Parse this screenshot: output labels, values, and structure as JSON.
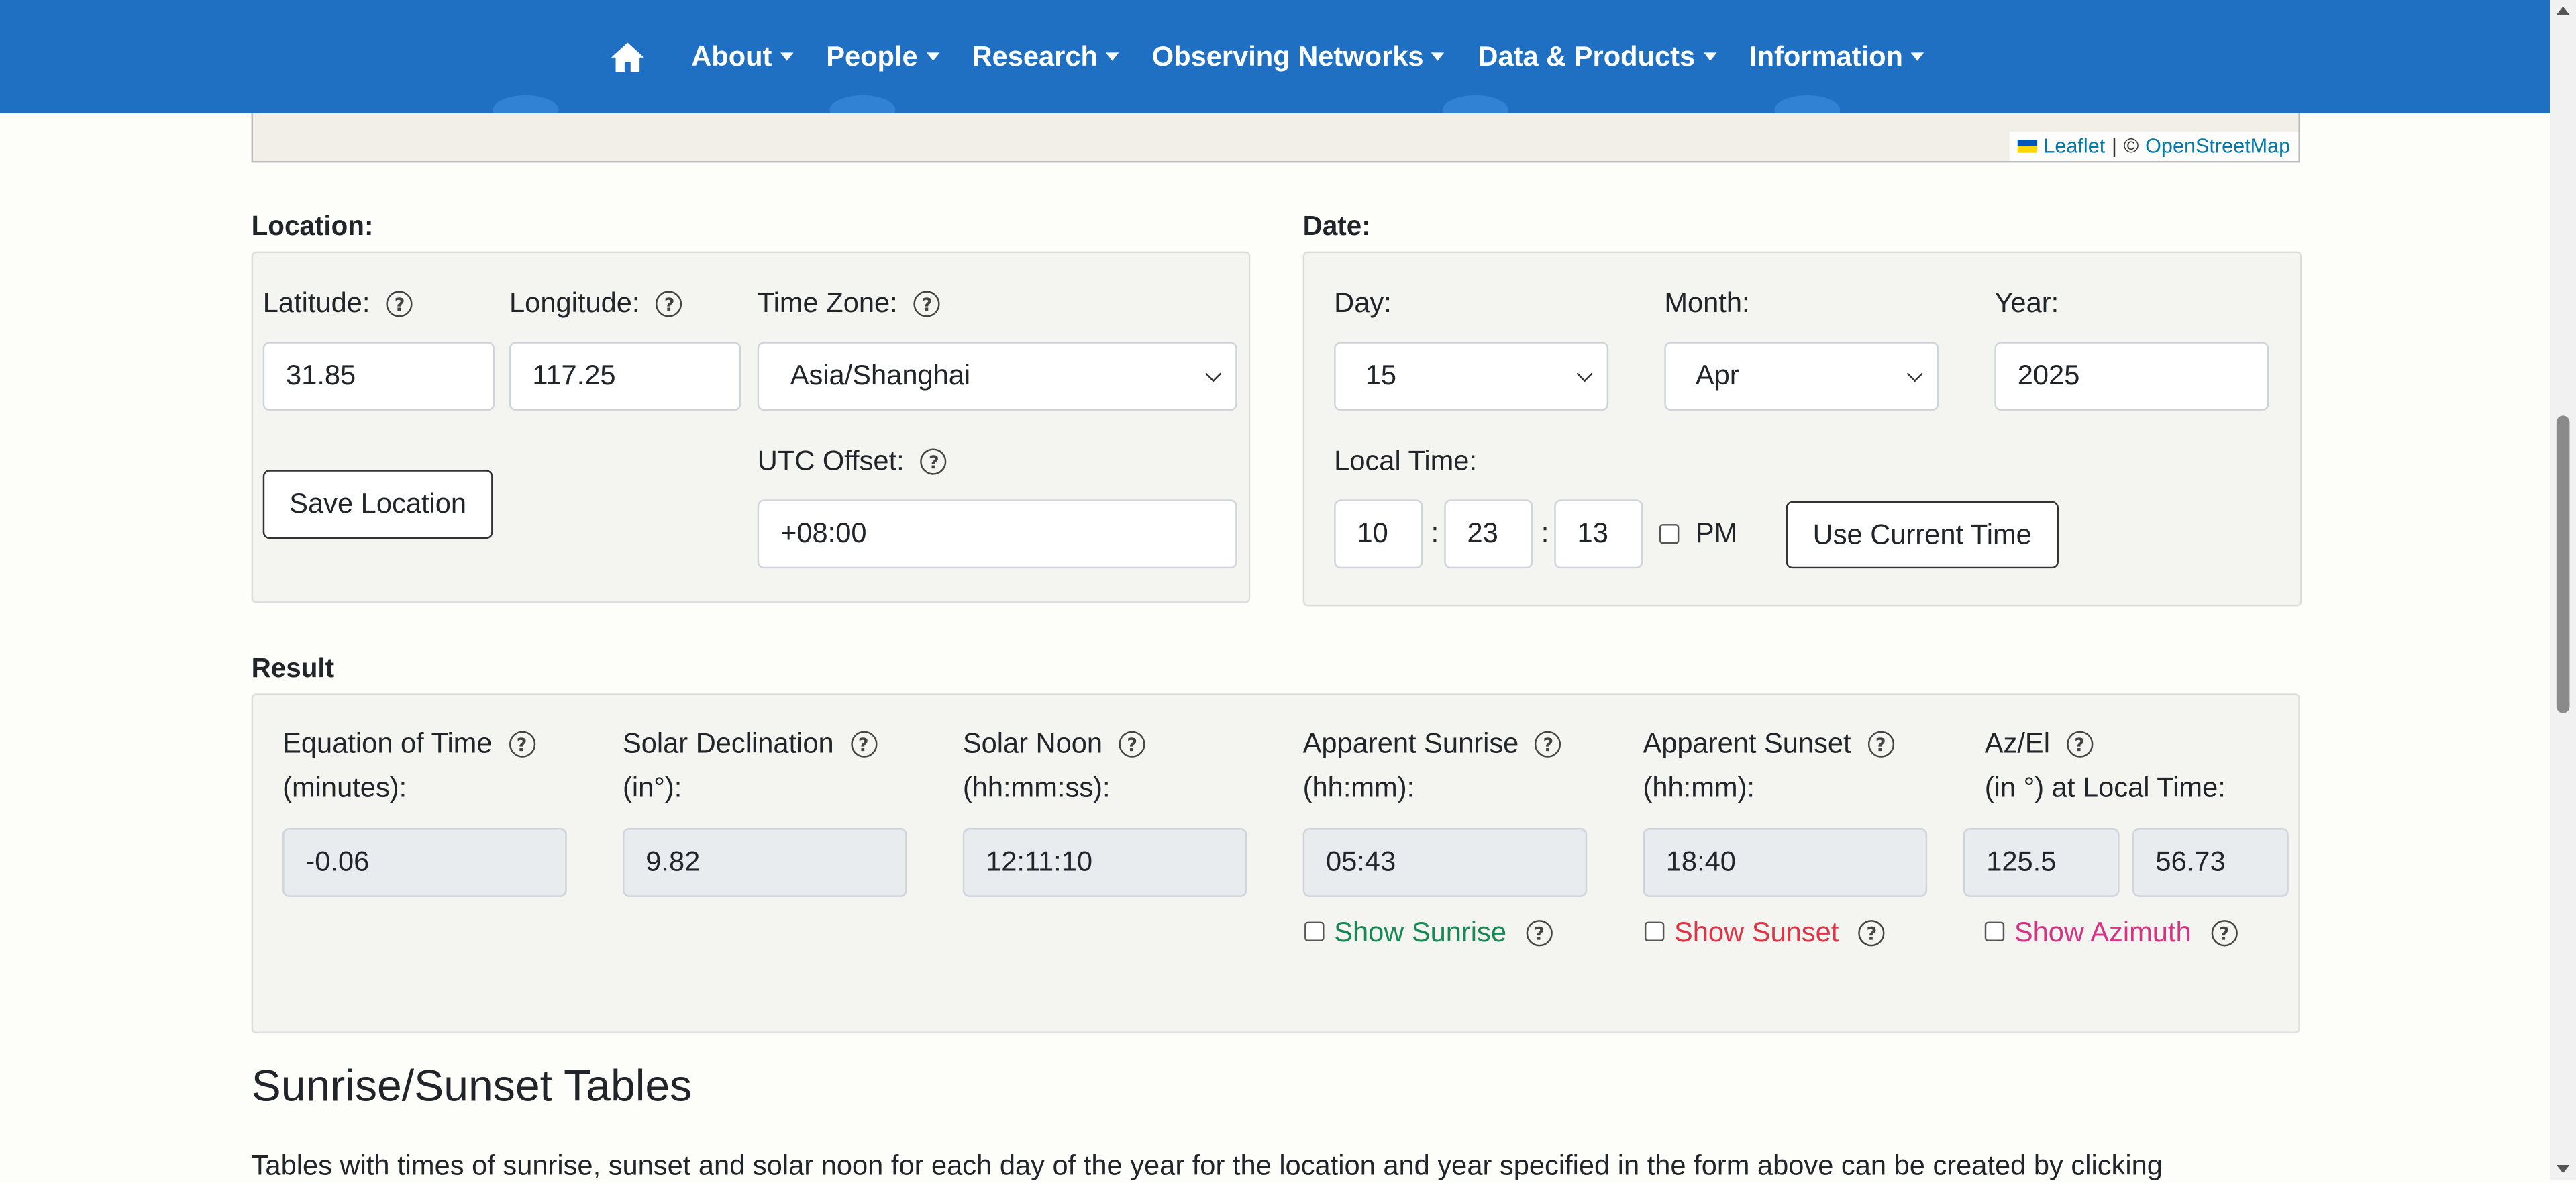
{
  "nav": {
    "home_icon": "home-icon",
    "items": [
      "About",
      "People",
      "Research",
      "Observing Networks",
      "Data & Products",
      "Information"
    ],
    "bg_color": "#1f6fc3"
  },
  "map": {
    "attribution_leaflet": "Leaflet",
    "attribution_sep": "|",
    "attribution_copy": "©",
    "attribution_osm": "OpenStreetMap"
  },
  "location": {
    "title": "Location:",
    "latitude_label": "Latitude:",
    "latitude": "31.85",
    "longitude_label": "Longitude:",
    "longitude": "117.25",
    "timezone_label": "Time Zone:",
    "timezone": "Asia/Shanghai",
    "save_button": "Save Location",
    "utc_label": "UTC Offset:",
    "utc": "+08:00"
  },
  "date": {
    "title": "Date:",
    "day_label": "Day:",
    "day": "15",
    "month_label": "Month:",
    "month": "Apr",
    "year_label": "Year:",
    "year": "2025",
    "localtime_label": "Local Time:",
    "hour": "10",
    "minute": "23",
    "second": "13",
    "colon": ":",
    "pm_label": "PM",
    "use_current_button": "Use Current Time"
  },
  "result": {
    "title": "Result",
    "eot_label1": "Equation of Time",
    "eot_label2": "(minutes):",
    "eot": "-0.06",
    "decl_label1": "Solar Declination",
    "decl_label2": "(in°):",
    "decl": "9.82",
    "noon_label1": "Solar Noon",
    "noon_label2": "(hh:mm:ss):",
    "noon": "12:11:10",
    "sunrise_label1": "Apparent Sunrise",
    "sunrise_label2": "(hh:mm):",
    "sunrise": "05:43",
    "sunset_label1": "Apparent Sunset",
    "sunset_label2": "(hh:mm):",
    "sunset": "18:40",
    "azel_label1": "Az/El",
    "azel_label2": "(in °) at Local Time:",
    "az": "125.5",
    "el": "56.73",
    "show_sunrise": "Show Sunrise",
    "show_sunset": "Show Sunset",
    "show_azimuth": "Show Azimuth",
    "sunrise_color": "#198754",
    "sunset_color": "#dc3545",
    "azimuth_color": "#d63384"
  },
  "tables": {
    "heading": "Sunrise/Sunset Tables",
    "text": "Tables with times of sunrise, sunset and solar noon for each day of the year for the location and year specified in the form above can be created by clicking"
  }
}
